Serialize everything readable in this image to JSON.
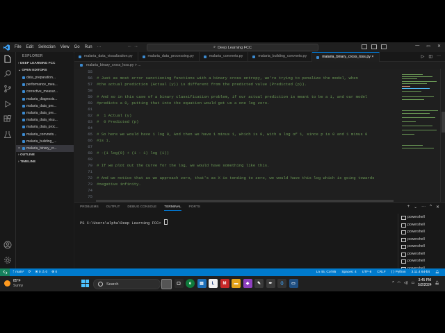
{
  "titlebar": {
    "menu": [
      "File",
      "Edit",
      "Selection",
      "View",
      "Go",
      "Run",
      "···"
    ],
    "command_center": "Deep Learning FCC",
    "window_controls": [
      "—",
      "▭",
      "✕"
    ]
  },
  "explorer": {
    "header": "EXPLORER",
    "workspace": "DEEP LEARNING FCC",
    "open_editors": "OPEN EDITORS",
    "files": [
      "data_preparation...",
      "performance_mea...",
      "corrective_measur...",
      "malaria_diagnosis...",
      "malaria_data_pre...",
      "malaria_data_pre...",
      "malaria_data_visu...",
      "malaria_data_proc...",
      "malaria_convnets...",
      "malaria_building_...",
      "malaria_binary_cr..."
    ],
    "outline": "OUTLINE",
    "timeline": "TIMELINE"
  },
  "tabs": [
    "malaria_data_visualization.py",
    "malaria_data_processing.py",
    "malaria_convnets.py",
    "malaria_building_convnets.py",
    "malaria_binary_cross_loss.py"
  ],
  "active_tab_close": "×",
  "breadcrumb": "malaria_binary_cross_loss.py > ...",
  "editor_lines": [
    {
      "n": "55",
      "t": ""
    },
    {
      "n": "56",
      "t": "# Just as most error sanctioning functions with a binary cross entropy, we're trying to penalize the model, when"
    },
    {
      "n": "57",
      "t": "#the actual prediction (Actual (y)) is different from the predicted value (Predicted (p))."
    },
    {
      "n": "58",
      "t": ""
    },
    {
      "n": "59",
      "t": "# And so in this case of a binary classification problem, if our actual prediction is meant to be a 1, and our model"
    },
    {
      "n": "60",
      "t": "#predicts a 0, putting that into the equation would get us a one log zero."
    },
    {
      "n": "61",
      "t": ""
    },
    {
      "n": "62",
      "t": "#  1 Actual (y)"
    },
    {
      "n": "63",
      "t": "#  0 Predicted (p)"
    },
    {
      "n": "64",
      "t": ""
    },
    {
      "n": "65",
      "t": "# So here we would have 1 log 0, And then we have 1 minus 1, which is 0, with a log of 1, since p is 0 and 1 minus 0"
    },
    {
      "n": "66",
      "t": "#is 1."
    },
    {
      "n": "67",
      "t": ""
    },
    {
      "n": "68",
      "t": "# -(1 log(0) + (1 - 1) log (1))"
    },
    {
      "n": "69",
      "t": ""
    },
    {
      "n": "70",
      "t": "# If we plot out the curve for the log, we would have something like this."
    },
    {
      "n": "71",
      "t": ""
    },
    {
      "n": "72",
      "t": "# And we notice that as we approach zero, that's as X is tending to zero, we would have this log which is going towards"
    },
    {
      "n": "73",
      "t": "#negative infinity."
    },
    {
      "n": "74",
      "t": ""
    },
    {
      "n": "75",
      "t": ""
    }
  ],
  "panel": {
    "tabs": [
      "PROBLEMS",
      "OUTPUT",
      "DEBUG CONSOLE",
      "TERMINAL",
      "PORTS"
    ],
    "active_tab": "TERMINAL",
    "prompt": "PS C:\\Users\\alpha\\Deep Learning FCC> ",
    "terminals": [
      "powershell",
      "powershell",
      "powershell",
      "powershell",
      "powershell",
      "powershell",
      "powershell",
      "powershell"
    ]
  },
  "statusbar": {
    "branch": "main*",
    "sync": "⟳",
    "errors": "⊗ 0 ⚠ 0",
    "ports": "⊛ 0",
    "position": "Ln 45, Col 85",
    "spaces": "Spaces: 4",
    "encoding": "UTF-8",
    "eol": "CRLF",
    "language": "{ } Python",
    "interpreter": "3.11.4 64-bit"
  },
  "taskbar": {
    "temp": "85°F",
    "condition": "Sunny",
    "search_placeholder": "Search",
    "time": "3:45 PM",
    "date": "5/2/2024"
  },
  "colors": {
    "accent": "#007acc",
    "comment": "#6a9955",
    "editor_bg": "#1f1f1f"
  }
}
